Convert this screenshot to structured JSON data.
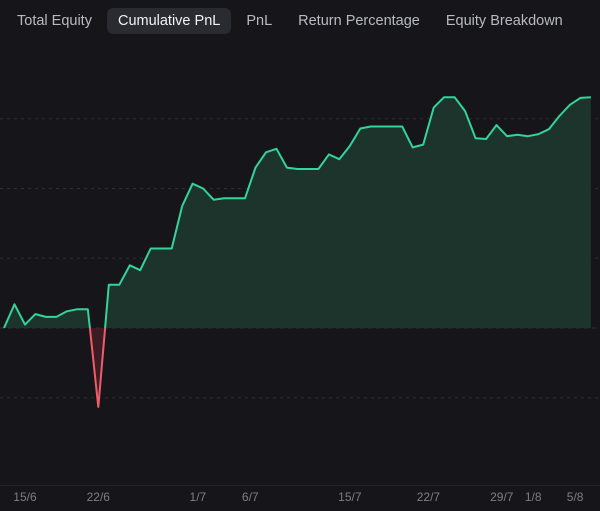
{
  "tabs": [
    {
      "label": "Total Equity",
      "active": false
    },
    {
      "label": "Cumulative PnL",
      "active": true
    },
    {
      "label": "PnL",
      "active": false
    },
    {
      "label": "Return Percentage",
      "active": false
    },
    {
      "label": "Equity Breakdown",
      "active": false
    }
  ],
  "colors": {
    "background": "#16161a",
    "positive_line": "#34d399",
    "positive_fill": "#1d3a30",
    "negative_line": "#ef5d6a",
    "negative_fill": "#4a1f26",
    "grid": "#2d2d33",
    "tick_text": "#7d7d86"
  },
  "chart_data": {
    "type": "area",
    "title": "",
    "xlabel": "",
    "ylabel": "",
    "x_tick_labels": [
      "15/6",
      "22/6",
      "1/7",
      "6/7",
      "15/7",
      "22/7",
      "29/7",
      "1/8",
      "5/8"
    ],
    "x_tick_positions": [
      2,
      9,
      18.5,
      23.5,
      33,
      40.5,
      47.5,
      50.5,
      54.5
    ],
    "x_range": [
      0,
      56.3
    ],
    "y_range": [
      -2.25,
      3.9
    ],
    "y_gridlines": [
      -1,
      0,
      1,
      2,
      3
    ],
    "grid": true,
    "series": [
      {
        "x": [
          0,
          1,
          2,
          3,
          4,
          5,
          6,
          7,
          8,
          9,
          10,
          11,
          12,
          13,
          14,
          15,
          16,
          17,
          18,
          19,
          20,
          21,
          22,
          23,
          24,
          25,
          26,
          27,
          28,
          29,
          30,
          31,
          32,
          33,
          34,
          35,
          36,
          37,
          38,
          39,
          40,
          41,
          42,
          43,
          44,
          45,
          46,
          47,
          48,
          49,
          50,
          51,
          52,
          53,
          54,
          55,
          56
        ],
        "y": [
          0.0,
          0.34,
          0.05,
          0.2,
          0.16,
          0.16,
          0.24,
          0.27,
          0.27,
          -1.13,
          0.62,
          0.62,
          0.9,
          0.83,
          1.14,
          1.14,
          1.14,
          1.75,
          2.07,
          2.0,
          1.84,
          1.86,
          1.86,
          1.86,
          2.3,
          2.52,
          2.57,
          2.3,
          2.28,
          2.28,
          2.28,
          2.49,
          2.42,
          2.61,
          2.86,
          2.89,
          2.89,
          2.89,
          2.89,
          2.59,
          2.63,
          3.16,
          3.31,
          3.31,
          3.11,
          2.72,
          2.71,
          2.91,
          2.75,
          2.77,
          2.75,
          2.78,
          2.85,
          3.04,
          3.2,
          3.3,
          3.31
        ]
      }
    ]
  }
}
